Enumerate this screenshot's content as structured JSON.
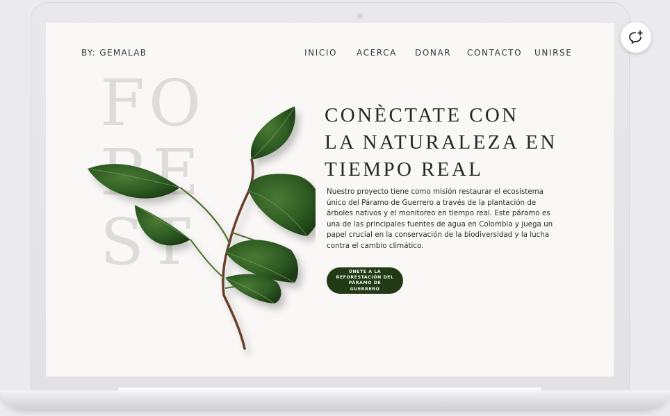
{
  "site": {
    "brand": "BY: GEMALAB",
    "nav": [
      "INICIO",
      "ACERCA",
      "DONAR",
      "CONTACTO",
      "UNIRSE"
    ],
    "background_word": "FOREST",
    "hero": {
      "title_lines": [
        "CONÈCTATE CON",
        "LA NATURALEZA EN",
        "TIEMPO REAL"
      ],
      "description": "Nuestro proyecto tiene como misión restaurar el ecosistema único del Páramo de Guerrero a través de la plantación de árboles nativos y el monitoreo en tiempo real. Este páramo es una de las principales fuentes de agua en Colombia y juega un papel crucial en la conservación de la biodiversidad y la lucha contra el cambio climático.",
      "cta_label": "ÚNETE A LA REFORESTACIÓN DEL PÁRAMO DE GUERRERO"
    }
  },
  "icons": {
    "chat": "chat-add-icon",
    "illustration": "leaf-branch-icon"
  },
  "colors": {
    "accent": "#203a14",
    "page_background": "#f9f8f6",
    "watermark_text": "#dedcd8",
    "leaf": "#2d5a22"
  }
}
